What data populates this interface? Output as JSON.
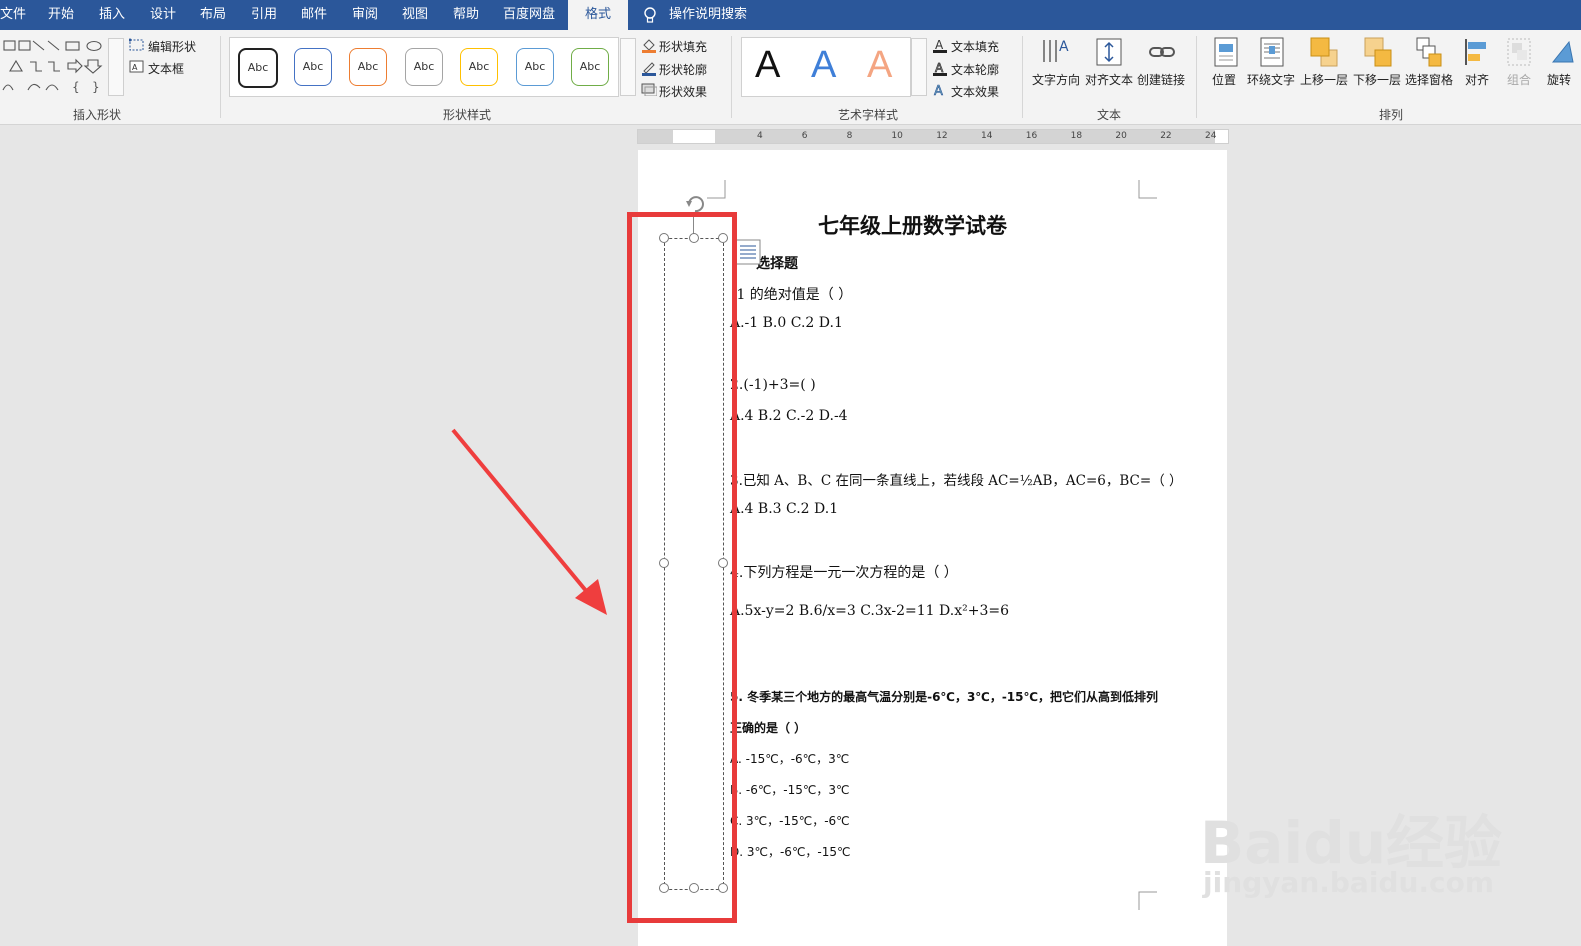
{
  "tabs": [
    {
      "label": "文件"
    },
    {
      "label": "开始"
    },
    {
      "label": "插入"
    },
    {
      "label": "设计"
    },
    {
      "label": "布局"
    },
    {
      "label": "引用"
    },
    {
      "label": "邮件"
    },
    {
      "label": "审阅"
    },
    {
      "label": "视图"
    },
    {
      "label": "帮助"
    },
    {
      "label": "百度网盘"
    },
    {
      "label": "格式"
    }
  ],
  "search": {
    "label": "操作说明搜索"
  },
  "ribbon": {
    "insert_shapes": {
      "edit_shape": "编辑形状",
      "text_box": "文本框",
      "group_label": "插入形状"
    },
    "shape_styles": {
      "sample": "Abc",
      "fill": "形状填充",
      "outline": "形状轮廓",
      "effects": "形状效果",
      "group_label": "形状样式"
    },
    "wordart": {
      "sample": "A",
      "fill": "文本填充",
      "outline": "文本轮廓",
      "effects": "文本效果",
      "group_label": "艺术字样式"
    },
    "text": {
      "direction": "文字方向",
      "align": "对齐文本",
      "link": "创建链接",
      "group_label": "文本"
    },
    "arrange": {
      "position": "位置",
      "wrap": "环绕文字",
      "forward": "上移一层",
      "backward": "下移一层",
      "pane": "选择窗格",
      "align": "对齐",
      "group": "组合",
      "rotate": "旋转",
      "group_label": "排列"
    }
  },
  "ruler_numbers": [
    "4",
    "6",
    "8",
    "10",
    "12",
    "14",
    "16",
    "18",
    "20",
    "22",
    "24"
  ],
  "document": {
    "title": "七年级上册数学试卷",
    "section": "选择题",
    "q1": ".1 的绝对值是（   ）",
    "q1_opts": "A.-1      B.0      C.2      D.1",
    "q2": "2.(-1)+3=(    )",
    "q2_opts": "A.4      B.2      C.-2      D.-4",
    "q3": "3.已知 A、B、C 在同一条直线上，若线段 AC=½AB，AC=6，BC=（    ）",
    "q3_opts": "A.4      B.3      C.2      D.1",
    "q4": "4.下列方程是一元一次方程的是（    ）",
    "q4_opts": "A.5x-y=2      B.6/x=3      C.3x-2=11      D.x²+3=6",
    "q5_line1": "5. 冬季某三个地方的最高气温分别是-6℃，3℃，-15℃，把它们从高到低排列",
    "q5_line2": "正确的是（    ）",
    "q5_a": "A. -15℃，-6℃，3℃",
    "q5_b": "B. -6℃，-15℃，3℃",
    "q5_c": "C. 3℃，-15℃，-6℃",
    "q5_d": "D. 3℃，-6℃，-15℃"
  },
  "watermark": {
    "brand": "Baidu经验",
    "url": "jingyan.baidu.com"
  },
  "colors": {
    "titlebar": "#2b579a",
    "highlight": "#e83b3b",
    "arrow": "#ef3e3e"
  }
}
